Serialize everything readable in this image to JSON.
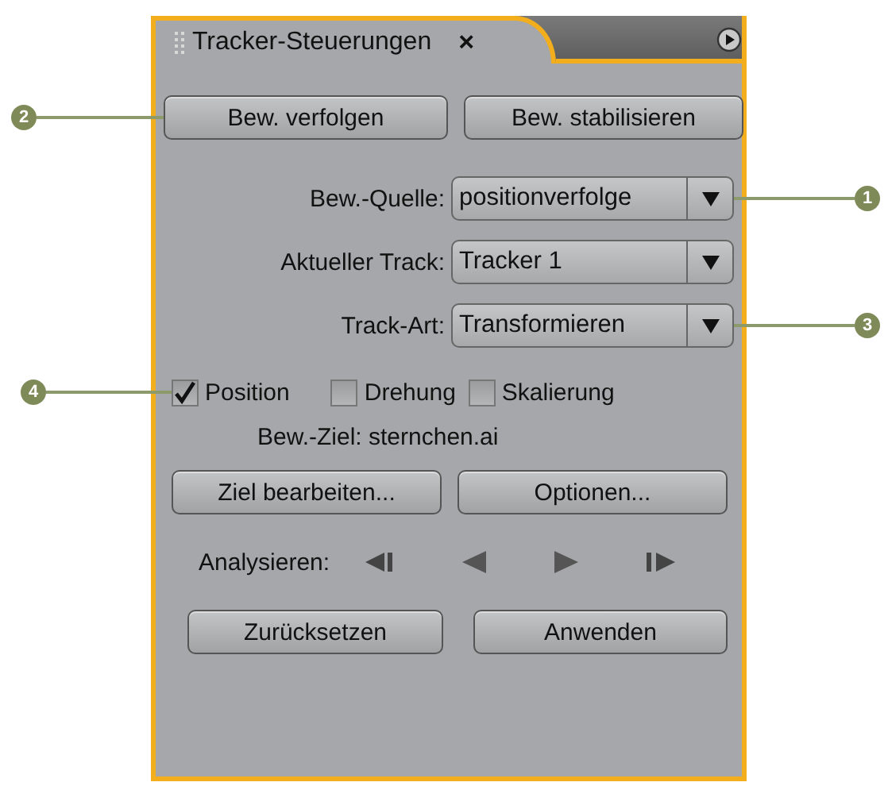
{
  "panel": {
    "title": "Tracker-Steuerungen",
    "close": "×"
  },
  "track_buttons": [
    {
      "label": "Bew. verfolgen",
      "callout": "2"
    },
    {
      "label": "Bew. stabilisieren"
    }
  ],
  "dropdowns": [
    {
      "label": "Bew.-Quelle:",
      "value": "positionverfolge",
      "callout": "1"
    },
    {
      "label": "Aktueller Track:",
      "value": "Tracker 1"
    },
    {
      "label": "Track-Art:",
      "value": "Transformieren",
      "callout": "3"
    }
  ],
  "checkboxes": [
    {
      "label": "Position",
      "checked": true,
      "callout": "4"
    },
    {
      "label": "Drehung",
      "checked": false
    },
    {
      "label": "Skalierung",
      "checked": false
    }
  ],
  "motion_target": "Bew.-Ziel: sternchen.ai",
  "target_buttons": [
    {
      "label": "Ziel bearbeiten..."
    },
    {
      "label": "Optionen..."
    }
  ],
  "analyze": {
    "label": "Analysieren:",
    "controls": [
      {
        "kind": "step-back"
      },
      {
        "kind": "back"
      },
      {
        "kind": "forward"
      },
      {
        "kind": "step-forward"
      }
    ]
  },
  "action_buttons": [
    {
      "label": "Zurücksetzen"
    },
    {
      "label": "Anwenden"
    }
  ]
}
